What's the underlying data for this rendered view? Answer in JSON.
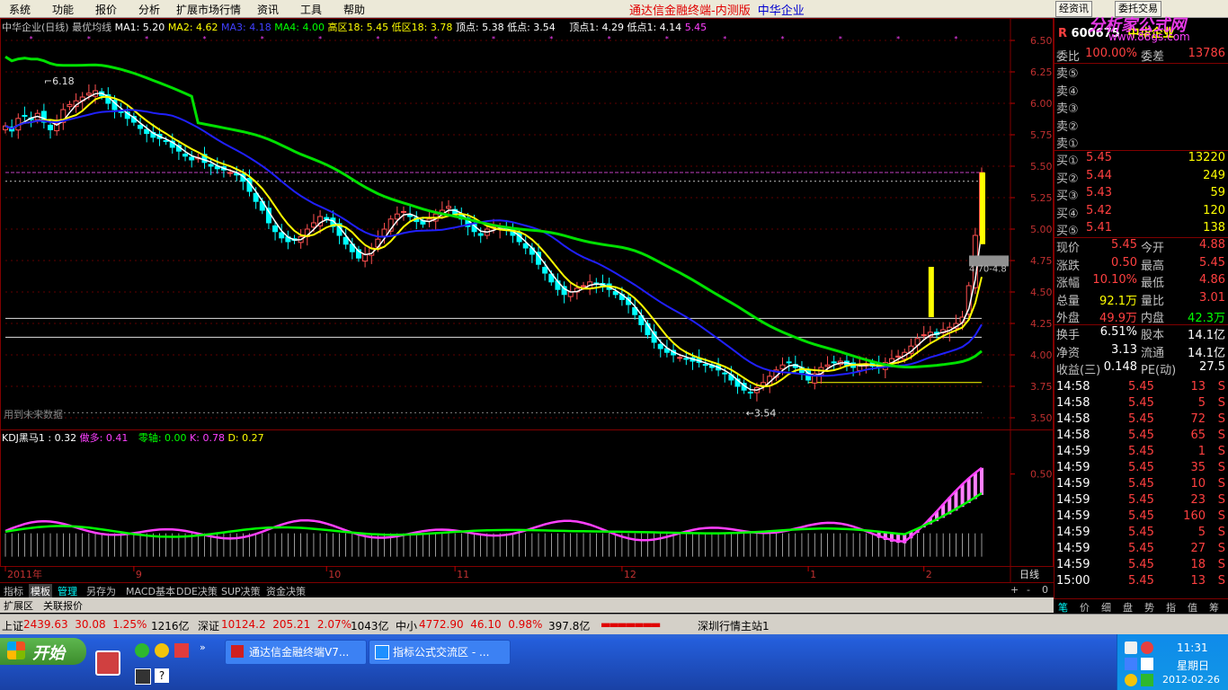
{
  "menu": [
    "系统",
    "功能",
    "报价",
    "分析",
    "扩展市场行情",
    "资讯",
    "工具",
    "帮助"
  ],
  "app_title": "通达信金融终端-内测版",
  "stock_name": "中华企业",
  "toolbar_right": [
    "经资讯",
    "委托交易"
  ],
  "watermark": {
    "site": "分析家公式网",
    "url": "www.88gs.com"
  },
  "chart": {
    "info": {
      "title": "中华企业(日线) 最优均线",
      "ma1": "MA1: 5.20",
      "ma2": "MA2: 4.62",
      "ma3": "MA3: 4.18",
      "ma4": "MA4: 4.00",
      "high": "高区18: 5.45",
      "low": "低区18: 3.78",
      "top": "顶点: 5.38",
      "bottom": "低点: 3.54",
      "top1": "顶点1: 4.29",
      "low1": "低点1: 4.14",
      "extra": "5.45"
    },
    "price_ticks": [
      "6.50",
      "6.25",
      "6.00",
      "5.75",
      "5.50",
      "5.25",
      "5.00",
      "4.75",
      "4.50",
      "4.25",
      "4.00",
      "3.75",
      "3.50"
    ],
    "annot_high": "6.18",
    "annot_low": "3.54",
    "range_label": "4.70-4.8",
    "future_note": "用到未来数据",
    "kdj": {
      "name": "KDJ黑马1 : 0.32",
      "duo": "做多: 0.41",
      "zero": "零轴: 0.00",
      "k": "K: 0.78",
      "d": "D: 0.27"
    },
    "kdj_tick": "0.50",
    "x_labels": [
      {
        "label": "2011年",
        "i": 0
      },
      {
        "label": "9",
        "i": 20
      },
      {
        "label": "10",
        "i": 50
      },
      {
        "label": "11",
        "i": 70
      },
      {
        "label": "12",
        "i": 96
      },
      {
        "label": "1",
        "i": 125
      },
      {
        "label": "2",
        "i": 143
      }
    ],
    "period": "日线",
    "colors": {
      "ma_fast": "#ffffff",
      "ma2": "#ffff00",
      "ma3": "#2020ff",
      "ma4": "#00e000",
      "kdj_k": "#ff40ff",
      "kdj_d": "#00ff00",
      "up": "#ff5050",
      "down": "#00ffff"
    }
  },
  "chart_data": {
    "type": "candlestick",
    "ylim": [
      3.45,
      6.55
    ],
    "closes": [
      5.82,
      5.78,
      5.88,
      5.9,
      5.87,
      5.92,
      5.85,
      5.79,
      5.84,
      5.95,
      5.99,
      6.02,
      6.05,
      6.08,
      6.1,
      6.06,
      6.0,
      5.95,
      5.93,
      5.88,
      5.85,
      5.8,
      5.76,
      5.73,
      5.72,
      5.7,
      5.65,
      5.62,
      5.58,
      5.55,
      5.57,
      5.53,
      5.5,
      5.48,
      5.47,
      5.45,
      5.43,
      5.38,
      5.3,
      5.22,
      5.15,
      5.05,
      4.98,
      4.93,
      4.9,
      4.91,
      4.94,
      5.0,
      5.05,
      5.1,
      5.08,
      5.02,
      4.95,
      4.88,
      4.82,
      4.77,
      4.8,
      4.85,
      4.92,
      5.0,
      5.08,
      5.12,
      5.14,
      5.1,
      5.06,
      5.04,
      5.08,
      5.12,
      5.15,
      5.18,
      5.12,
      5.08,
      5.02,
      4.98,
      4.95,
      5.0,
      5.02,
      5.01,
      4.99,
      4.95,
      4.9,
      4.85,
      4.8,
      4.72,
      4.65,
      4.58,
      4.52,
      4.48,
      4.5,
      4.53,
      4.55,
      4.58,
      4.56,
      4.54,
      4.52,
      4.48,
      4.44,
      4.4,
      4.32,
      4.24,
      4.16,
      4.1,
      4.05,
      4.02,
      4.0,
      3.98,
      3.97,
      3.95,
      3.94,
      3.92,
      3.9,
      3.88,
      3.85,
      3.8,
      3.75,
      3.72,
      3.7,
      3.74,
      3.78,
      3.83,
      3.88,
      3.92,
      3.94,
      3.9,
      3.86,
      3.8,
      3.85,
      3.9,
      3.92,
      3.94,
      3.95,
      3.92,
      3.9,
      3.92,
      3.93,
      3.91,
      3.9,
      3.94,
      3.97,
      3.99,
      4.02,
      4.07,
      4.13,
      4.16,
      4.18,
      4.16,
      4.2,
      4.22,
      4.25,
      4.3,
      4.55,
      4.95,
      5.45
    ],
    "annotations": {
      "high": 6.18,
      "low": 3.54
    }
  }
}
